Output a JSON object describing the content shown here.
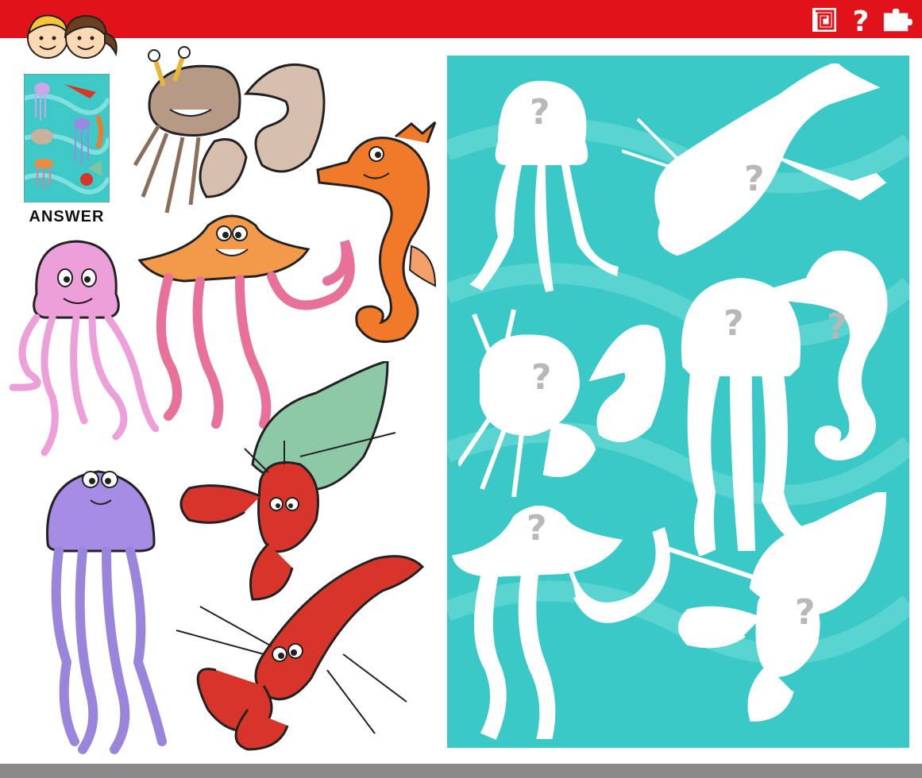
{
  "answer_label": "ANSWER",
  "question_mark": "?",
  "colors": {
    "top_bar": "#e0121a",
    "bottom_bar": "#8a8a8a",
    "panel": "#3ac9c6",
    "silhouette": "#ffffff",
    "question_mark": "#b8b8b8"
  },
  "top_icons": [
    "maze-icon",
    "question-icon",
    "puzzle-icon"
  ],
  "creatures": [
    "crab",
    "seahorse",
    "pink-jellyfish",
    "orange-jellyfish",
    "hermit-crab",
    "purple-jellyfish",
    "lobster"
  ],
  "silhouettes": [
    "jellyfish",
    "lobster",
    "crab",
    "jellyfish",
    "seahorse",
    "jellyfish",
    "hermit-crab"
  ]
}
